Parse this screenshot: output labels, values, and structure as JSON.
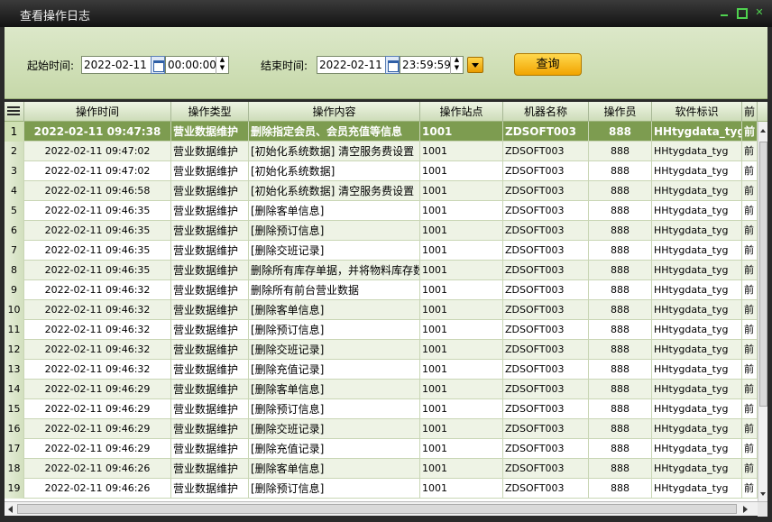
{
  "window": {
    "title": "查看操作日志"
  },
  "filter": {
    "start_label": "起始时间:",
    "start_date": "2022-02-11",
    "start_time": "00:00:00",
    "end_label": "结束时间:",
    "end_date": "2022-02-11",
    "end_time": "23:59:59",
    "query_label": "查询"
  },
  "table": {
    "columns": [
      "操作时间",
      "操作类型",
      "操作内容",
      "操作站点",
      "机器名称",
      "操作员",
      "软件标识",
      "前"
    ],
    "rows": [
      {
        "n": "1",
        "time": "2022-02-11 09:47:38",
        "type": "营业数据维护",
        "content": "删除指定会员、会员充值等信息",
        "site": "1001",
        "machine": "ZDSOFT003",
        "op": "888",
        "soft": "HHtygdata_tyg",
        "extra": "前"
      },
      {
        "n": "2",
        "time": "2022-02-11 09:47:02",
        "type": "营业数据维护",
        "content": "[初始化系统数据] 清空服务费设置",
        "site": "1001",
        "machine": "ZDSOFT003",
        "op": "888",
        "soft": "HHtygdata_tyg",
        "extra": "前"
      },
      {
        "n": "3",
        "time": "2022-02-11 09:47:02",
        "type": "营业数据维护",
        "content": "[初始化系统数据]",
        "site": "1001",
        "machine": "ZDSOFT003",
        "op": "888",
        "soft": "HHtygdata_tyg",
        "extra": "前"
      },
      {
        "n": "4",
        "time": "2022-02-11 09:46:58",
        "type": "营业数据维护",
        "content": "[初始化系统数据] 清空服务费设置",
        "site": "1001",
        "machine": "ZDSOFT003",
        "op": "888",
        "soft": "HHtygdata_tyg",
        "extra": "前"
      },
      {
        "n": "5",
        "time": "2022-02-11 09:46:35",
        "type": "营业数据维护",
        "content": "[删除客单信息]",
        "site": "1001",
        "machine": "ZDSOFT003",
        "op": "888",
        "soft": "HHtygdata_tyg",
        "extra": "前"
      },
      {
        "n": "6",
        "time": "2022-02-11 09:46:35",
        "type": "营业数据维护",
        "content": "[删除预订信息]",
        "site": "1001",
        "machine": "ZDSOFT003",
        "op": "888",
        "soft": "HHtygdata_tyg",
        "extra": "前"
      },
      {
        "n": "7",
        "time": "2022-02-11 09:46:35",
        "type": "营业数据维护",
        "content": "[删除交班记录]",
        "site": "1001",
        "machine": "ZDSOFT003",
        "op": "888",
        "soft": "HHtygdata_tyg",
        "extra": "前"
      },
      {
        "n": "8",
        "time": "2022-02-11 09:46:35",
        "type": "营业数据维护",
        "content": "删除所有库存单据，并将物料库存数",
        "site": "1001",
        "machine": "ZDSOFT003",
        "op": "888",
        "soft": "HHtygdata_tyg",
        "extra": "前"
      },
      {
        "n": "9",
        "time": "2022-02-11 09:46:32",
        "type": "营业数据维护",
        "content": "删除所有前台营业数据",
        "site": "1001",
        "machine": "ZDSOFT003",
        "op": "888",
        "soft": "HHtygdata_tyg",
        "extra": "前"
      },
      {
        "n": "10",
        "time": "2022-02-11 09:46:32",
        "type": "营业数据维护",
        "content": "[删除客单信息]",
        "site": "1001",
        "machine": "ZDSOFT003",
        "op": "888",
        "soft": "HHtygdata_tyg",
        "extra": "前"
      },
      {
        "n": "11",
        "time": "2022-02-11 09:46:32",
        "type": "营业数据维护",
        "content": "[删除预订信息]",
        "site": "1001",
        "machine": "ZDSOFT003",
        "op": "888",
        "soft": "HHtygdata_tyg",
        "extra": "前"
      },
      {
        "n": "12",
        "time": "2022-02-11 09:46:32",
        "type": "营业数据维护",
        "content": "[删除交班记录]",
        "site": "1001",
        "machine": "ZDSOFT003",
        "op": "888",
        "soft": "HHtygdata_tyg",
        "extra": "前"
      },
      {
        "n": "13",
        "time": "2022-02-11 09:46:32",
        "type": "营业数据维护",
        "content": "[删除充值记录]",
        "site": "1001",
        "machine": "ZDSOFT003",
        "op": "888",
        "soft": "HHtygdata_tyg",
        "extra": "前"
      },
      {
        "n": "14",
        "time": "2022-02-11 09:46:29",
        "type": "营业数据维护",
        "content": "[删除客单信息]",
        "site": "1001",
        "machine": "ZDSOFT003",
        "op": "888",
        "soft": "HHtygdata_tyg",
        "extra": "前"
      },
      {
        "n": "15",
        "time": "2022-02-11 09:46:29",
        "type": "营业数据维护",
        "content": "[删除预订信息]",
        "site": "1001",
        "machine": "ZDSOFT003",
        "op": "888",
        "soft": "HHtygdata_tyg",
        "extra": "前"
      },
      {
        "n": "16",
        "time": "2022-02-11 09:46:29",
        "type": "营业数据维护",
        "content": "[删除交班记录]",
        "site": "1001",
        "machine": "ZDSOFT003",
        "op": "888",
        "soft": "HHtygdata_tyg",
        "extra": "前"
      },
      {
        "n": "17",
        "time": "2022-02-11 09:46:29",
        "type": "营业数据维护",
        "content": "[删除充值记录]",
        "site": "1001",
        "machine": "ZDSOFT003",
        "op": "888",
        "soft": "HHtygdata_tyg",
        "extra": "前"
      },
      {
        "n": "18",
        "time": "2022-02-11 09:46:26",
        "type": "营业数据维护",
        "content": "[删除客单信息]",
        "site": "1001",
        "machine": "ZDSOFT003",
        "op": "888",
        "soft": "HHtygdata_tyg",
        "extra": "前"
      },
      {
        "n": "19",
        "time": "2022-02-11 09:46:26",
        "type": "营业数据维护",
        "content": "[删除预订信息]",
        "site": "1001",
        "machine": "ZDSOFT003",
        "op": "888",
        "soft": "HHtygdata_tyg",
        "extra": "前"
      }
    ]
  }
}
